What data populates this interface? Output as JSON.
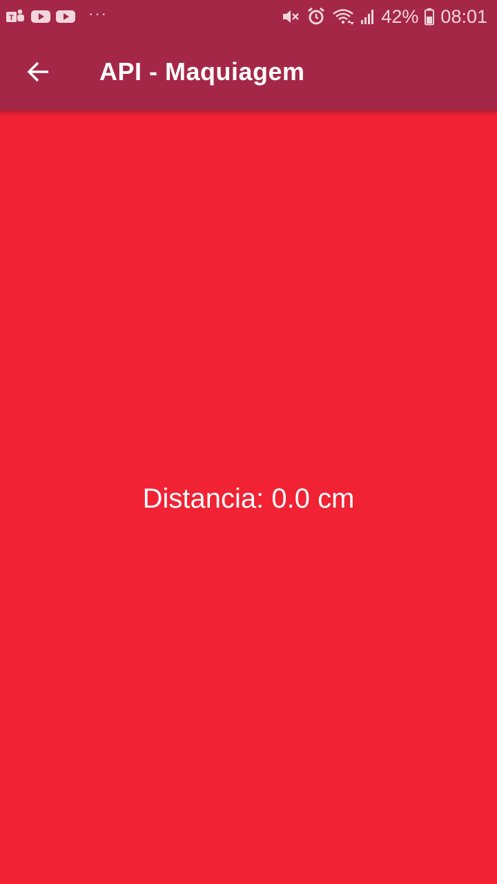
{
  "status_bar": {
    "notification_icons": [
      "teams-icon",
      "youtube-icon",
      "youtube-icon"
    ],
    "more_indicator": "···",
    "system_icons": [
      "mute-icon",
      "alarm-icon",
      "wifi-icon",
      "signal-icon",
      "battery-icon"
    ],
    "battery": "42%",
    "time": "08:01"
  },
  "app_bar": {
    "back_icon": "arrow-back-icon",
    "title": "API - Maquiagem",
    "color": "#a52747"
  },
  "main": {
    "background": "#f02233",
    "distance_text": "Distancia: 0.0 cm"
  }
}
